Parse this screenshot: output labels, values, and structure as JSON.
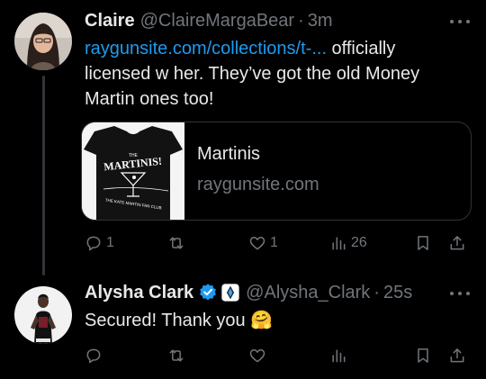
{
  "tweets": [
    {
      "name": "Claire",
      "handle": "@ClaireMargaBear",
      "separator": "·",
      "time": "3m",
      "link_text": "raygunsite.com/collections/t-...",
      "text_line1": " officially",
      "text_line2": "licensed w her. They’ve got the old Money",
      "text_line3": "Martin ones too!",
      "card": {
        "title": "Martinis",
        "domain": "raygunsite.com",
        "shirt_text_top": "THE",
        "shirt_text_main": "MARTINIS!",
        "shirt_text_bottom": "THE KATE MARTIN FAN CLUB"
      },
      "replies": "1",
      "likes": "1",
      "views": "26"
    },
    {
      "name": "Alysha Clark",
      "handle": "@Alysha_Clark",
      "separator": "·",
      "time": "25s",
      "text": "Secured! Thank you ",
      "emoji": "🤗"
    }
  ],
  "colors": {
    "background": "#000000",
    "text": "#e7e9ea",
    "muted": "#71767b",
    "link": "#1d9bf0",
    "verified": "#1d9bf0",
    "border": "#2f3336"
  }
}
